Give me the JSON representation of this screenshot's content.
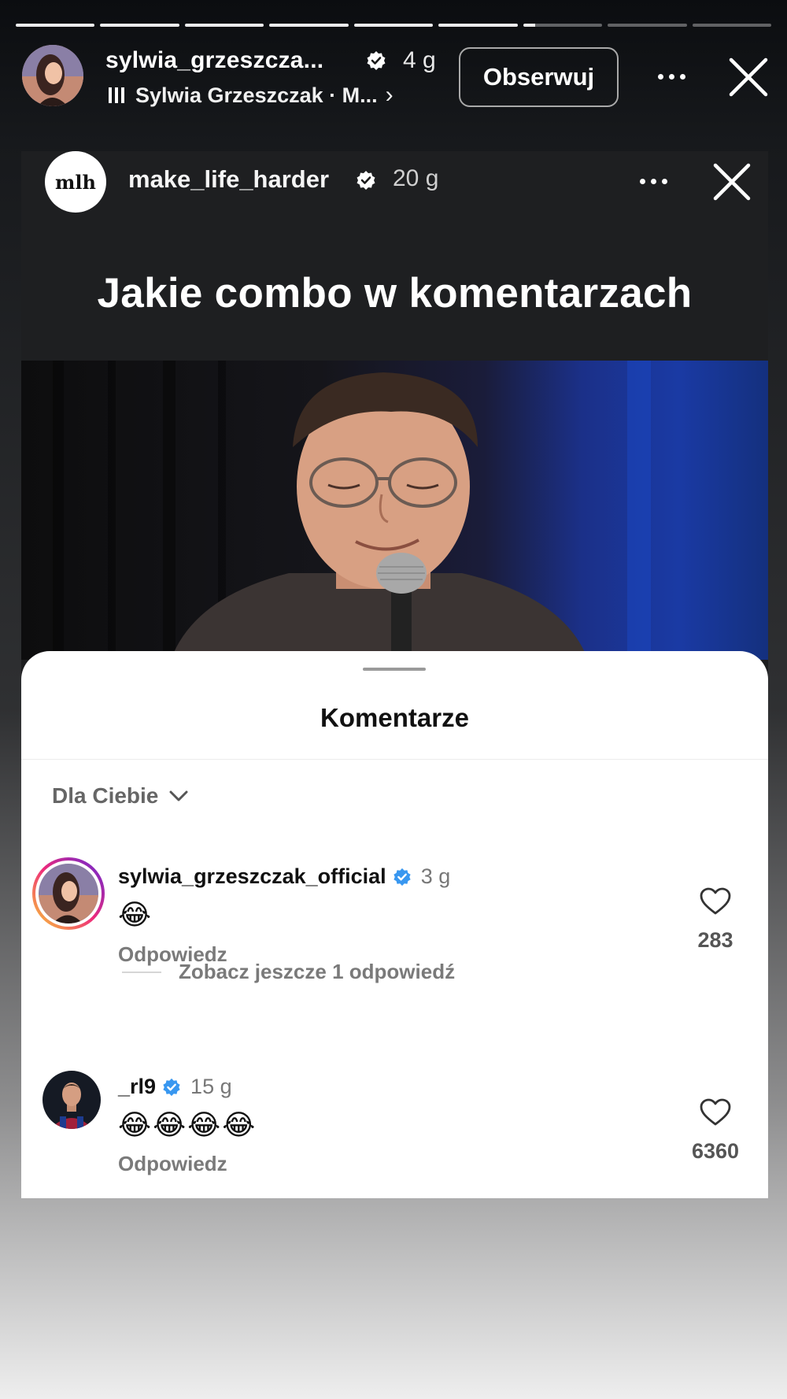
{
  "story": {
    "segments_done": 6,
    "segments_total": 9,
    "username": "sylwia_grzeszcza...",
    "time": "4 g",
    "music": "Sylwia Grzeszczak · M...",
    "music_chevron": "›",
    "follow_label": "Obserwuj"
  },
  "shared_post": {
    "username": "make_life_harder",
    "time": "20 g",
    "logo_text": "mlh",
    "title": "Jakie combo w komentarzach"
  },
  "comments_sheet": {
    "title": "Komentarze",
    "sort_label": "Dla Ciebie",
    "comments": [
      {
        "username": "sylwia_grzeszczak_official",
        "time": "3 g",
        "emoji": "😂",
        "reply_label": "Odpowiedz",
        "likes": "283"
      },
      {
        "username": "_rl9",
        "time": "15 g",
        "emoji": "😂😂😂😂",
        "reply_label": "Odpowiedz",
        "likes": "6360"
      }
    ],
    "more_replies_label": "Zobacz jeszcze 1 odpowiedź"
  },
  "colors": {
    "verified_blue": "#3897f0",
    "story_ring_start": "#f9ce34",
    "story_ring_end": "#ee2a7b"
  },
  "icons": [
    "verified-icon",
    "music-bars-icon",
    "more-icon",
    "close-icon",
    "chevron-down-icon",
    "heart-icon"
  ]
}
